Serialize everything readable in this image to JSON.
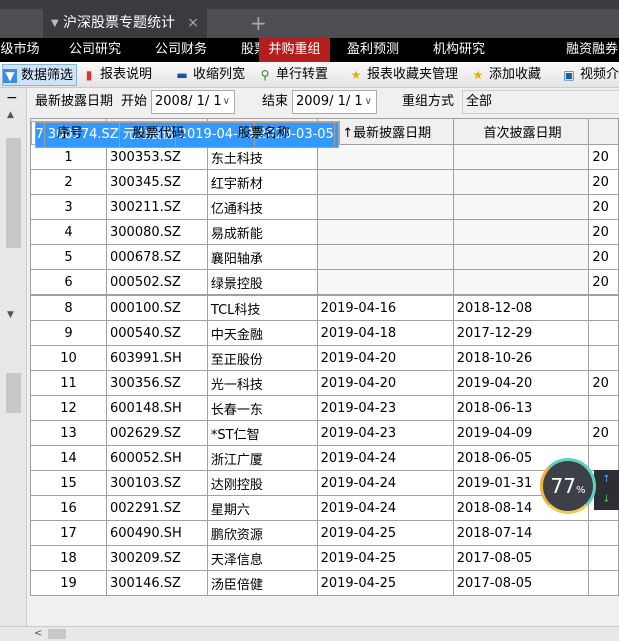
{
  "tab": {
    "title": "沪深股票专题统计",
    "close": "×",
    "add": "+"
  },
  "nav": [
    "级市场",
    "公司研究",
    "公司财务",
    "股票质押",
    "并购重组",
    "盈利预测",
    "机构研究",
    "融资融券"
  ],
  "toolbar": [
    "数据筛选",
    "报表说明",
    "收缩列宽",
    "单行转置",
    "报表收藏夹管理",
    "添加收藏",
    "视频介绍"
  ],
  "filter": {
    "date_label": "最新披露日期",
    "start_label": "开始",
    "start": "2008/  1/  1",
    "end_label": "结束",
    "end": "2009/  1/  1",
    "method_label": "重组方式",
    "method": "全部"
  },
  "columns": [
    "序号",
    "股票代码",
    "股票名称",
    "↑最新披露日期",
    "首次披露日期"
  ],
  "rows": [
    [
      "1",
      "300353.SZ",
      "东土科技",
      "",
      "",
      "20"
    ],
    [
      "2",
      "300345.SZ",
      "红宇新材",
      "",
      "",
      "20"
    ],
    [
      "3",
      "300211.SZ",
      "亿通科技",
      "",
      "",
      "20"
    ],
    [
      "4",
      "300080.SZ",
      "易成新能",
      "",
      "",
      "20"
    ],
    [
      "5",
      "000678.SZ",
      "襄阳轴承",
      "",
      "",
      "20"
    ],
    [
      "6",
      "000502.SZ",
      "绿景控股",
      "",
      "",
      "20"
    ],
    [
      "7",
      "300174.SZ",
      "元力股份",
      "2019-04-13",
      "2019-03-05",
      ""
    ],
    [
      "8",
      "000100.SZ",
      "TCL科技",
      "2019-04-16",
      "2018-12-08",
      ""
    ],
    [
      "9",
      "000540.SZ",
      "中天金融",
      "2019-04-18",
      "2017-12-29",
      ""
    ],
    [
      "10",
      "603991.SH",
      "至正股份",
      "2019-04-20",
      "2018-10-26",
      ""
    ],
    [
      "11",
      "300356.SZ",
      "光一科技",
      "2019-04-20",
      "2019-04-20",
      "20"
    ],
    [
      "12",
      "600148.SH",
      "长春一东",
      "2019-04-23",
      "2018-06-13",
      ""
    ],
    [
      "13",
      "002629.SZ",
      "*ST仁智",
      "2019-04-23",
      "2019-04-09",
      "20"
    ],
    [
      "14",
      "600052.SH",
      "浙江广厦",
      "2019-04-24",
      "2018-06-05",
      ""
    ],
    [
      "15",
      "300103.SZ",
      "达刚控股",
      "2019-04-24",
      "2019-01-31",
      ""
    ],
    [
      "16",
      "002291.SZ",
      "星期六",
      "2019-04-24",
      "2018-08-14",
      ""
    ],
    [
      "17",
      "600490.SH",
      "鹏欣资源",
      "2019-04-25",
      "2018-07-14",
      ""
    ],
    [
      "18",
      "300209.SZ",
      "天泽信息",
      "2019-04-25",
      "2017-08-05",
      ""
    ],
    [
      "19",
      "300146.SZ",
      "汤臣倍健",
      "2019-04-25",
      "2017-08-05",
      ""
    ]
  ],
  "selected_row": 7,
  "gauge": {
    "value": "77",
    "unit": "%"
  }
}
